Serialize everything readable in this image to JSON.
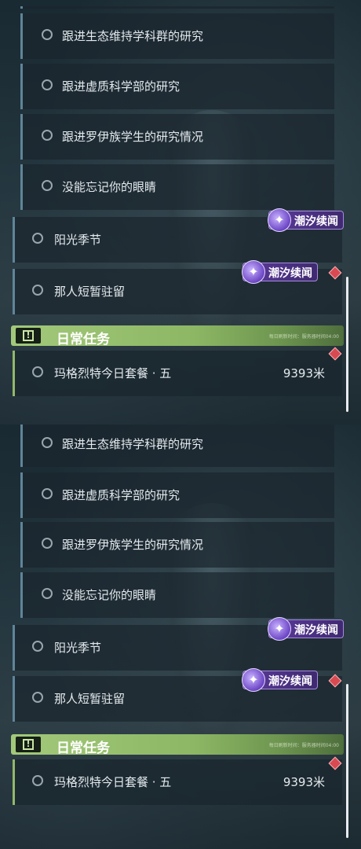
{
  "panels": [
    {
      "sub_quests": [
        {
          "label": "跟进生态维持学科群的研究"
        },
        {
          "label": "跟进虚质科学部的研究"
        },
        {
          "label": "跟进罗伊族学生的研究情况"
        },
        {
          "label": "没能忘记你的眼睛"
        }
      ],
      "main_quests": [
        {
          "label": "阳光季节",
          "tag": "潮汐续闻"
        },
        {
          "label": "那人短暂驻留",
          "tag": "潮汐续闻"
        }
      ],
      "daily": {
        "title": "日常任务",
        "note": "每日刷新时间：服务器时间04:00",
        "quest": {
          "label": "玛格烈特今日套餐 · 五",
          "distance": "9393米"
        }
      }
    },
    {
      "sub_quests": [
        {
          "label": "跟进生态维持学科群的研究"
        },
        {
          "label": "跟进虚质科学部的研究"
        },
        {
          "label": "跟进罗伊族学生的研究情况"
        },
        {
          "label": "没能忘记你的眼睛"
        }
      ],
      "main_quests": [
        {
          "label": "阳光季节",
          "tag": "潮汐续闻"
        },
        {
          "label": "那人短暂驻留",
          "tag": "潮汐续闻"
        }
      ],
      "daily": {
        "title": "日常任务",
        "note": "每日刷新时间：服务器时间04:00",
        "quest": {
          "label": "玛格烈特今日套餐 · 五",
          "distance": "9393米"
        }
      }
    }
  ],
  "icons": {
    "radio": "radio-empty-icon",
    "tag": "tide-sparkle-icon",
    "alert": "exclamation-box-icon",
    "marker": "red-diamond-icon"
  },
  "colors": {
    "accent_blue": "#5f8599",
    "accent_green": "#92b86a",
    "tag_purple": "#5c3a9c",
    "marker_red": "#d84a52"
  }
}
